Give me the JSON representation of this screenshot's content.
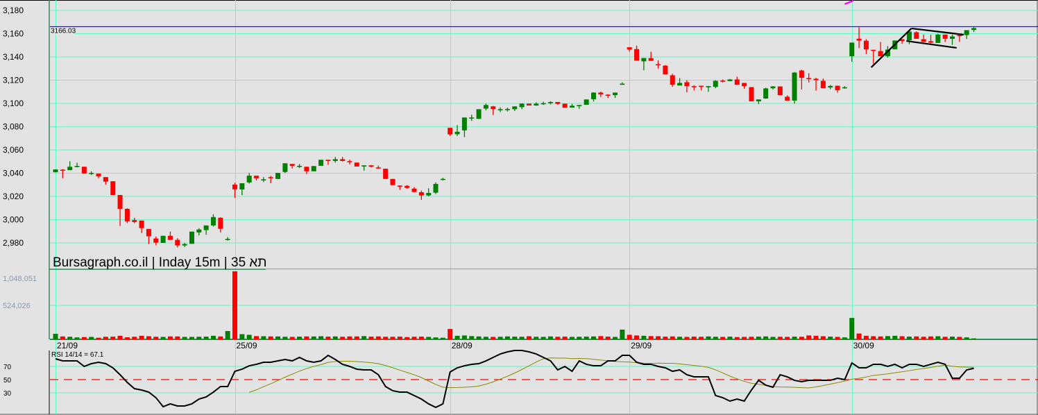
{
  "chart_data": {
    "type": "candlestick",
    "title": "Bursagraph.co.il | Inday 15m | 35 תא",
    "price_axis": {
      "ticks": [
        2980,
        3000,
        3020,
        3040,
        3060,
        3080,
        3100,
        3120,
        3140,
        3160,
        3180
      ],
      "tick_labels": [
        "2,980",
        "3,000",
        "3,020",
        "3,040",
        "3,060",
        "3,080",
        "3,100",
        "3,120",
        "3,140",
        "3,160",
        "3,180"
      ],
      "range": [
        2957,
        3189
      ]
    },
    "reference_line": {
      "value": 3166.03,
      "label": "3166.03",
      "color": "#000080"
    },
    "date_labels": [
      {
        "index": 0,
        "label": "21/09"
      },
      {
        "index": 25,
        "label": "25/09"
      },
      {
        "index": 55,
        "label": "28/09"
      },
      {
        "index": 80,
        "label": "29/09"
      },
      {
        "index": 111,
        "label": "30/09"
      }
    ],
    "colors": {
      "up": "#008000",
      "down": "#ff0000",
      "grid": "#66f5c4",
      "rsi": "#000000",
      "rsi_signal": "#8a8a00",
      "rsi_mid": "#ff0000"
    },
    "candles_oc_hl": [
      [
        3040.8,
        3043.2
      ],
      [
        3043,
        3042.6,
        3043.5,
        3035.6
      ],
      [
        3042.6,
        3045.5,
        3050.3
      ],
      [
        3045.8,
        3046.2,
        3049,
        3045
      ],
      [
        3045.5,
        3039.6
      ],
      [
        3039.8,
        3040.2,
        3041.6,
        3038.4
      ],
      [
        3039.6,
        3037.2,
        3039.6,
        3035.6
      ],
      [
        3036.6,
        3032.7,
        3036.6,
        3030
      ],
      [
        3033,
        3021.2
      ],
      [
        3021.2,
        3009.3,
        3021.2,
        2994.5
      ],
      [
        3009.3,
        2998.6,
        3009.8,
        2997
      ],
      [
        2999.6,
        2998,
        3001.6,
        2997
      ],
      [
        2999.2,
        2992.7,
        2999.2,
        2988.5
      ],
      [
        2992,
        2985.7,
        2992,
        2979
      ],
      [
        2983.8,
        2980.2,
        2985.5,
        2978
      ],
      [
        2980,
        2986.1
      ],
      [
        2986.1,
        2982.6,
        2989.7,
        2982.6
      ],
      [
        2982.6,
        2977.8,
        2984,
        2976
      ],
      [
        2977.8,
        2979,
        2980,
        2976.5
      ],
      [
        2979.2,
        2989.7
      ],
      [
        2989,
        2991.5,
        2992.7,
        2986.5
      ],
      [
        2991,
        2995,
        2995,
        2987
      ],
      [
        2995,
        3002.2,
        3004.6,
        2994
      ],
      [
        3001.6,
        2992.1,
        3002,
        2989
      ],
      [
        2983,
        2983.4,
        2985,
        2982
      ],
      [
        3030.1,
        3026.1,
        3031.7,
        3018.8
      ],
      [
        3026,
        3031.3,
        3031.3,
        3021
      ],
      [
        3032,
        3037.8,
        3040.2,
        3031
      ],
      [
        3037.8,
        3035.6,
        3037.8,
        3033.7
      ],
      [
        3034.3,
        3034.7,
        3036.6,
        3032.3
      ],
      [
        3036.6,
        3036.2,
        3037.6,
        3031.3
      ],
      [
        3035,
        3040.2
      ],
      [
        3041,
        3048.5,
        3048.5,
        3040
      ],
      [
        3047.9,
        3046.3,
        3047.9,
        3044
      ],
      [
        3046,
        3046.3,
        3047.9,
        3044.4
      ],
      [
        3045.5,
        3041.6,
        3045.5,
        3039.2
      ],
      [
        3041.6,
        3046.1
      ],
      [
        3046.3,
        3051.5
      ],
      [
        3051.5,
        3050.5,
        3051.5,
        3047.1
      ],
      [
        3050.5,
        3052,
        3053.9,
        3049
      ],
      [
        3052,
        3050.5,
        3053.9,
        3050
      ],
      [
        3050.3,
        3049.5,
        3051.6,
        3047.5
      ],
      [
        3049.1,
        3045.7
      ],
      [
        3046,
        3046.7,
        3046.7,
        3042.2
      ],
      [
        3046.7,
        3045.5,
        3047,
        3045
      ],
      [
        3044.9,
        3044,
        3046.5,
        3044
      ],
      [
        3043.8,
        3035
      ],
      [
        3035,
        3029.7
      ],
      [
        3029.3,
        3029.1,
        3029.5,
        3025.7
      ],
      [
        3029.1,
        3027.3,
        3029.7,
        3026.5
      ],
      [
        3026.7,
        3023.8,
        3028,
        3023.5
      ],
      [
        3023.6,
        3020.8,
        3025,
        3017
      ],
      [
        3020.8,
        3023,
        3027,
        3020
      ],
      [
        3023.2,
        3030.7,
        3032,
        3022
      ],
      [
        3034.7,
        3035.1,
        3036,
        3033.7
      ],
      [
        3079,
        3073.3,
        3079,
        3072
      ],
      [
        3073.5,
        3075.6,
        3081.4,
        3072
      ],
      [
        3076.8,
        3087.9,
        3087.9,
        3071
      ],
      [
        3087.5,
        3087.9,
        3090.3,
        3085
      ],
      [
        3086.7,
        3095
      ],
      [
        3095.5,
        3098.6,
        3099.8,
        3094
      ],
      [
        3097.4,
        3095.2,
        3097.8,
        3090
      ],
      [
        3094.6,
        3095,
        3096.6,
        3092.5
      ],
      [
        3094.8,
        3095.2,
        3096.4,
        3093
      ],
      [
        3095,
        3097.4,
        3097.4,
        3093.5
      ],
      [
        3096.8,
        3099.8,
        3100,
        3095
      ],
      [
        3099.8,
        3098.2
      ],
      [
        3098.2,
        3099.8,
        3101,
        3098
      ],
      [
        3099.8,
        3100.2,
        3101.5,
        3098.8
      ],
      [
        3100.2,
        3101.2,
        3101.8,
        3099
      ],
      [
        3101.2,
        3099.6,
        3101.2,
        3098.8
      ],
      [
        3099.8,
        3096.4
      ],
      [
        3096.4,
        3098,
        3099.6,
        3096.4
      ],
      [
        3098.2,
        3098.6,
        3098.6,
        3095.4
      ],
      [
        3098.8,
        3103.4
      ],
      [
        3103.6,
        3109.3,
        3109.5,
        3101.6
      ],
      [
        3109.3,
        3107.7,
        3110.1,
        3105.5
      ],
      [
        3107.5,
        3107.1,
        3107.9,
        3104.7
      ],
      [
        3107.1,
        3109.3,
        3109.3,
        3104.7
      ],
      [
        3116.6,
        3117,
        3118.2,
        3116
      ],
      [
        3148.3,
        3146.3,
        3148.3,
        3144.5
      ],
      [
        3146.7,
        3136.8,
        3149.7,
        3136.8
      ],
      [
        3136.2,
        3139,
        3139,
        3128.5
      ],
      [
        3139,
        3136.6,
        3144.4,
        3136.6
      ],
      [
        3133.7,
        3133.3,
        3137,
        3130
      ],
      [
        3132.5,
        3125,
        3133,
        3125
      ],
      [
        3124.2,
        3116,
        3125.5,
        3114.3
      ],
      [
        3115.4,
        3117.6,
        3121.8,
        3115.4
      ],
      [
        3118.2,
        3114.8,
        3120,
        3109.5
      ],
      [
        3114.8,
        3114.4,
        3115.6,
        3111.2
      ],
      [
        3115.2,
        3114.2,
        3115.2,
        3111.2
      ],
      [
        3114.4,
        3114.8,
        3115,
        3110
      ],
      [
        3114.2,
        3119.4,
        3120,
        3113
      ],
      [
        3119.6,
        3119.2,
        3120.6,
        3118
      ],
      [
        3119.2,
        3120.6,
        3121,
        3119.2
      ],
      [
        3120.6,
        3116,
        3123,
        3116
      ],
      [
        3117.6,
        3114.8,
        3117.6,
        3112.5
      ],
      [
        3114,
        3101.8
      ],
      [
        3101.8,
        3103.4,
        3103.4,
        3099.4
      ],
      [
        3104.2,
        3112.9,
        3113.5,
        3104
      ],
      [
        3113,
        3114.6,
        3114.8,
        3112
      ],
      [
        3114.6,
        3107.1
      ],
      [
        3105.7,
        3102.4,
        3107,
        3102.4
      ],
      [
        3102.4,
        3126.5,
        3127,
        3099.8
      ],
      [
        3128.3,
        3122,
        3129,
        3112
      ],
      [
        3121.8,
        3121.4,
        3126,
        3118
      ],
      [
        3121.2,
        3120,
        3122,
        3111
      ],
      [
        3119.4,
        3113.1,
        3121.4,
        3113.1
      ],
      [
        3113.7,
        3115,
        3115.8,
        3112.2
      ],
      [
        3115.2,
        3111.3,
        3115.2,
        3109.3
      ],
      [
        3113.5,
        3113.9,
        3114.8,
        3112.6
      ],
      [
        3140.6,
        3152.3,
        3152.3,
        3135.8
      ],
      [
        3155.6,
        3154,
        3165.5,
        3147.7
      ],
      [
        3153.9,
        3146.5,
        3155.2,
        3142.4
      ],
      [
        3146.1,
        3145.7,
        3146.1,
        3133.9
      ],
      [
        3145,
        3140.6,
        3152.9,
        3140.6
      ],
      [
        3140.6,
        3146.3,
        3149.3,
        3139.4
      ],
      [
        3146.5,
        3154.1,
        3154.1,
        3146.5
      ],
      [
        3155.2,
        3153.7,
        3155.2,
        3151.3
      ],
      [
        3154.3,
        3161.8,
        3162.6,
        3150.9
      ],
      [
        3161.2,
        3155.6,
        3162,
        3155.6
      ],
      [
        3155.2,
        3152.9,
        3159.2,
        3152.9
      ],
      [
        3153.5,
        3152.3,
        3159,
        3150.8
      ],
      [
        3152,
        3159.2,
        3160,
        3152
      ],
      [
        3159.2,
        3155.6,
        3159.2,
        3152.9
      ],
      [
        3155.6,
        3157.6,
        3159.2,
        3150.3
      ],
      [
        3158.8,
        3158.2,
        3158.8,
        3152.9
      ],
      [
        3158.8,
        3163,
        3163,
        3155.4
      ],
      [
        3163.2,
        3164.8,
        3165.7,
        3161.4
      ]
    ],
    "trend_lines": [
      {
        "from": [
          113.7,
          3131
        ],
        "to": [
          119.3,
          3164.5
        ],
        "color": "#000000"
      },
      {
        "from": [
          119.3,
          3164.5
        ],
        "to": [
          126.6,
          3159.1
        ],
        "color": "#000000"
      },
      {
        "from": [
          118.6,
          3153.7
        ],
        "to": [
          125.6,
          3147.8
        ],
        "color": "#000000"
      },
      {
        "from": [
          110,
          3185.4
        ],
        "to": [
          111.2,
          3188.4
        ],
        "color": "#ff00ff"
      }
    ],
    "volume": {
      "tick_labels": [
        "1,048,051",
        "524,026"
      ],
      "ticks": [
        1048051,
        524026
      ],
      "max": 1048051,
      "values": [
        86000,
        45000,
        40000,
        30000,
        35000,
        38000,
        25000,
        40000,
        42000,
        55000,
        32000,
        40000,
        55000,
        48000,
        40000,
        38000,
        45000,
        45000,
        38000,
        38000,
        40000,
        42000,
        55000,
        45000,
        128000,
        1048051,
        80000,
        70000,
        50000,
        48000,
        45000,
        45000,
        40000,
        38000,
        42000,
        45000,
        45000,
        48000,
        42000,
        45000,
        40000,
        45000,
        45000,
        50000,
        42000,
        45000,
        40000,
        40000,
        42000,
        35000,
        40000,
        42000,
        38000,
        30000,
        25000,
        160000,
        55000,
        60000,
        50000,
        45000,
        40000,
        38000,
        40000,
        45000,
        42000,
        40000,
        48000,
        40000,
        38000,
        45000,
        40000,
        42000,
        38000,
        40000,
        42000,
        45000,
        50000,
        42000,
        38000,
        150000,
        70000,
        60000,
        55000,
        50000,
        48000,
        42000,
        45000,
        40000,
        38000,
        42000,
        40000,
        45000,
        40000,
        38000,
        42000,
        35000,
        38000,
        40000,
        42000,
        45000,
        38000,
        40000,
        38000,
        42000,
        40000,
        60000,
        55000,
        48000,
        42000,
        38000,
        30000,
        330000,
        90000,
        55000,
        48000,
        45000,
        50000,
        55000,
        48000,
        42000,
        45000,
        40000,
        45000,
        48000,
        40000,
        42000,
        38000,
        30000,
        15000
      ]
    },
    "rsi": {
      "label": "RSI 14/14 = 67.1",
      "period": 14,
      "signal_period": 14,
      "ticks": [
        70,
        50,
        30
      ],
      "tick_labels": [
        "70",
        "50",
        "30"
      ],
      "values": [
        81.6,
        78.4,
        78.4,
        78.4,
        70,
        74.2,
        76.3,
        74.2,
        67.9,
        57.4,
        45.8,
        36.3,
        34.2,
        31,
        22.6,
        8.9,
        13.2,
        10,
        10,
        13.2,
        20.5,
        23.7,
        31,
        39.5,
        39.5,
        62.6,
        65.8,
        71,
        73.2,
        76.3,
        76.3,
        78.4,
        80.5,
        78.4,
        83.7,
        78.4,
        76.3,
        78.4,
        86.8,
        80.5,
        73.2,
        70,
        65.8,
        64.7,
        64.7,
        57.4,
        39.5,
        33.2,
        31,
        31,
        25.8,
        20.5,
        13.2,
        7.9,
        13.2,
        61.6,
        67.9,
        71,
        73.2,
        74.2,
        78.4,
        83.7,
        88.9,
        92.1,
        94.2,
        94.2,
        92.1,
        88.9,
        83.7,
        78.4,
        64.7,
        70,
        62.6,
        78.4,
        73.2,
        71,
        71,
        78.4,
        78.4,
        86.8,
        86.8,
        76.3,
        73.2,
        73.2,
        70,
        67.9,
        62.6,
        64.7,
        57.4,
        54.2,
        54.2,
        54.2,
        25.8,
        22.6,
        17.4,
        20.5,
        17.4,
        34.2,
        48.9,
        41.6,
        38.4,
        57.4,
        54.2,
        48.9,
        46.8,
        48.9,
        48.9,
        48.9,
        48.9,
        52.1,
        50,
        75.3,
        67.9,
        67.9,
        73.2,
        73.2,
        70,
        73.2,
        67.9,
        73.2,
        73.2,
        70,
        73.2,
        76.3,
        73.2,
        52.1,
        52.1,
        64.7,
        67.1
      ]
    }
  }
}
